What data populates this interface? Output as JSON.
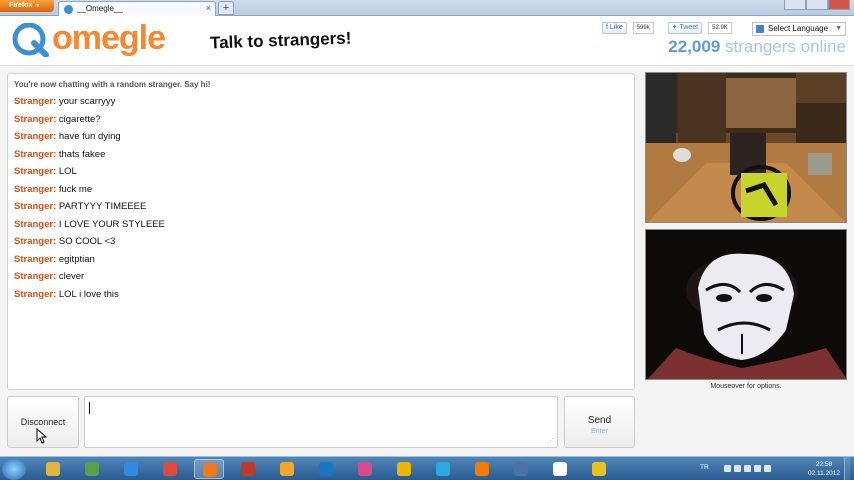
{
  "browser": {
    "menu_button_label": "Firefox",
    "tab_title": "__Omegle__",
    "new_tab_label": "+",
    "tab_close_label": "×"
  },
  "header": {
    "logo_text": "omegle",
    "tagline": "Talk to strangers!",
    "like_label": "Like",
    "like_count": "599k",
    "tweet_label": "Tweet",
    "tweet_count": "52.9K",
    "language_label": "Select Language",
    "online_count": "22,009",
    "online_suffix": "strangers online"
  },
  "chat": {
    "status": "You're now chatting with a random stranger. Say hi!",
    "messages": [
      {
        "who": "Stranger:",
        "text": "your scarryyy"
      },
      {
        "who": "Stranger:",
        "text": "cigarette?"
      },
      {
        "who": "Stranger:",
        "text": "have fun dying"
      },
      {
        "who": "Stranger:",
        "text": "thats fakee"
      },
      {
        "who": "Stranger:",
        "text": "LOL"
      },
      {
        "who": "Stranger:",
        "text": "fuck me"
      },
      {
        "who": "Stranger:",
        "text": "PARTYYY TIMEEEE"
      },
      {
        "who": "Stranger:",
        "text": "I LOVE YOUR STYLEEE"
      },
      {
        "who": "Stranger:",
        "text": "SO COOL <3"
      },
      {
        "who": "Stranger:",
        "text": "egitptian"
      },
      {
        "who": "Stranger:",
        "text": "clever"
      },
      {
        "who": "Stranger:",
        "text": "LOL i love this"
      }
    ]
  },
  "video": {
    "mouseover_hint": "Mouseover for options."
  },
  "controls": {
    "disconnect_label": "Disconnect",
    "message_value": "",
    "send_label": "Send",
    "send_hint": "Enter"
  },
  "taskbar": {
    "icons": [
      "explorer-icon",
      "network-icon",
      "internet-explorer-icon",
      "chrome-icon",
      "firefox-icon",
      "game-icon",
      "media-icon",
      "tool-icon",
      "picasa-icon",
      "vlc-like-icon",
      "skype-icon",
      "vlc-icon",
      "save-icon",
      "counter-strike-icon",
      "yellow-app-icon"
    ],
    "icon_colors": [
      "#e3b33c",
      "#5aa04a",
      "#2f8be0",
      "#e04a3a",
      "#f07a1a",
      "#c0392b",
      "#f5a623",
      "#1b76c2",
      "#d84a8a",
      "#f0b400",
      "#2da9e1",
      "#f07d00",
      "#4b72a8",
      "#ffffff",
      "#e8c020"
    ],
    "active_index": 4,
    "tray_lang": "TR",
    "clock_time": "22:58",
    "clock_date": "02.11.2012"
  },
  "colors": {
    "accent_orange": "#f7882f",
    "stranger_red": "#e04e12",
    "online_blue": "#5d9ad7"
  }
}
